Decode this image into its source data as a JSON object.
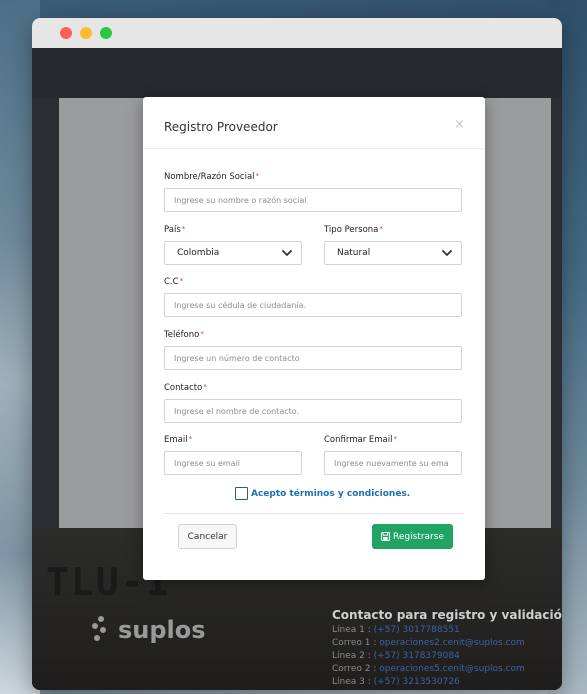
{
  "modal": {
    "title": "Registro Proveedor",
    "close_glyph": "×",
    "fields": {
      "nombre": {
        "label": "Nombre/Razón Social",
        "required_mark": "*",
        "placeholder": "Ingrese su nombre o razón social",
        "value": ""
      },
      "pais": {
        "label": "País",
        "required_mark": "*",
        "selected": "Colombia"
      },
      "tipo_persona": {
        "label": "Tipo Persona",
        "required_mark": "*",
        "selected": "Natural"
      },
      "cc": {
        "label": "C.C",
        "required_mark": "*",
        "placeholder": "Ingrese su cédula de ciudadanía.",
        "value": ""
      },
      "telefono": {
        "label": "Teléfono",
        "required_mark": "*",
        "placeholder": "Ingrese un número de contacto",
        "value": ""
      },
      "contacto": {
        "label": "Contacto",
        "required_mark": "*",
        "placeholder": "Ingrese el nombre de contacto.",
        "value": ""
      },
      "email": {
        "label": "Email",
        "required_mark": "*",
        "placeholder": "Ingrese su email",
        "value": ""
      },
      "confirmar_email": {
        "label": "Confirmar Email",
        "required_mark": "*",
        "placeholder": "Ingrese nuevamente su ema",
        "value": ""
      }
    },
    "terms_label": "Acepto términos y condiciones.",
    "terms_checked": false,
    "cancel_label": "Cancelar",
    "register_label": "Registrarse",
    "icons": {
      "close": "close-icon",
      "chevron": "chevron-down-icon",
      "save": "save-icon"
    },
    "colors": {
      "register_bg": "#1fa463",
      "link_blue": "#1f6fb3",
      "required": "#d33"
    }
  },
  "background": {
    "sign_text": "TLU-1",
    "logo_text": "suplos",
    "contact_title": "Contacto para registro y validación de p",
    "lines": [
      {
        "label": "Línea 1 :",
        "value": "(+57) 3017788551"
      },
      {
        "label": "Correo 1 :",
        "value": "operaciones2.cenit@suplos.com"
      },
      {
        "label": "Línea 2 :",
        "value": "(+57) 3178379084"
      },
      {
        "label": "Correo 2 :",
        "value": "operaciones5.cenit@suplos.com"
      },
      {
        "label": "Línea 3 :",
        "value": "(+57) 3213530726"
      }
    ]
  },
  "window_controls": {
    "close_color": "#ff5f57",
    "minimize_color": "#febc2e",
    "zoom_color": "#28c840"
  }
}
